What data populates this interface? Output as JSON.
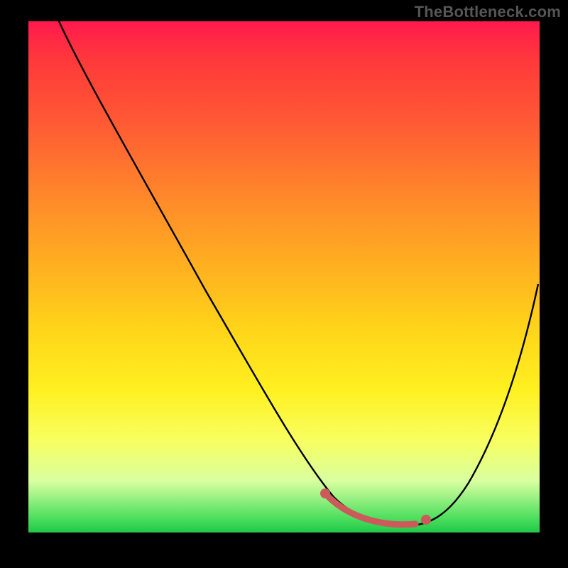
{
  "watermark": "TheBottleneck.com",
  "chart_data": {
    "type": "line",
    "title": "",
    "xlabel": "",
    "ylabel": "",
    "xlim": [
      0,
      100
    ],
    "ylim": [
      0,
      100
    ],
    "grid": false,
    "legend": false,
    "series": [
      {
        "name": "curve",
        "x": [
          6,
          10,
          15,
          20,
          25,
          30,
          35,
          40,
          45,
          50,
          55,
          58,
          62,
          65,
          68,
          72,
          76,
          80,
          84,
          88,
          92,
          96,
          99
        ],
        "y": [
          100,
          94,
          86,
          78,
          70,
          62,
          54,
          46,
          38,
          30,
          22,
          16,
          10,
          6,
          4,
          3,
          3,
          5,
          10,
          18,
          28,
          40,
          50
        ]
      }
    ],
    "markers": {
      "name": "highlight-range",
      "color": "#cc5a5a",
      "x_start": 58,
      "x_end": 80,
      "y_approx": 4
    },
    "background_gradient": {
      "top": "#ff1a4d",
      "mid1": "#ffb020",
      "mid2": "#fff020",
      "bottom": "#20c84a"
    }
  }
}
